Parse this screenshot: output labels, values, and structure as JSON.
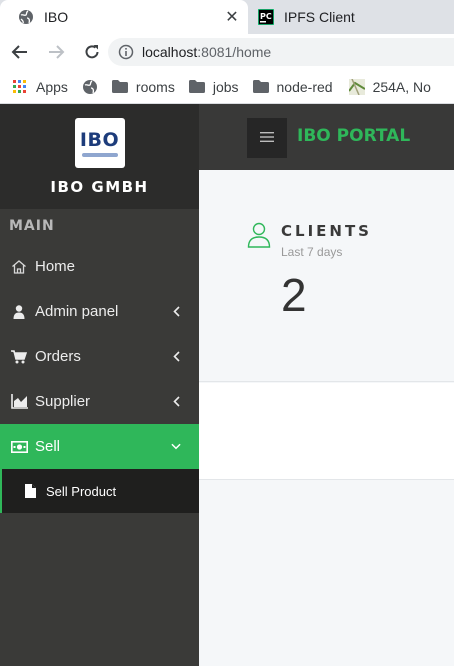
{
  "browser": {
    "tabs": [
      {
        "title": "IBO",
        "favicon": "globe-icon",
        "active": true
      },
      {
        "title": "IPFS Client",
        "favicon": "pycharm-icon",
        "active": false
      }
    ],
    "url": {
      "host": "localhost",
      "rest": ":8081/home"
    },
    "bookmarks": [
      {
        "label": "Apps",
        "icon": "apps-grid-icon"
      },
      {
        "label": "",
        "icon": "globe-icon"
      },
      {
        "label": "rooms",
        "icon": "folder-icon"
      },
      {
        "label": "jobs",
        "icon": "folder-icon"
      },
      {
        "label": "node-red",
        "icon": "folder-icon"
      },
      {
        "label": "254A, No",
        "icon": "map-thumbnail-icon"
      }
    ]
  },
  "sidebar": {
    "logo_text": "IBO",
    "brand_name": "IBO GMBH",
    "section_label": "MAIN",
    "items": [
      {
        "label": "Home",
        "icon": "home-icon",
        "has_chevron": false
      },
      {
        "label": "Admin panel",
        "icon": "user-icon",
        "has_chevron": true
      },
      {
        "label": "Orders",
        "icon": "cart-icon",
        "has_chevron": true
      },
      {
        "label": "Supplier",
        "icon": "chart-icon",
        "has_chevron": true
      },
      {
        "label": "Sell",
        "icon": "money-icon",
        "has_chevron": true,
        "expanded": true
      }
    ],
    "submenu": [
      {
        "label": "Sell Product",
        "icon": "file-icon"
      }
    ]
  },
  "header": {
    "title": "IBO PORTAL"
  },
  "stats": {
    "title": "CLIENTS",
    "subtitle": "Last 7 days",
    "value": "2",
    "icon": "user-outline-icon"
  },
  "colors": {
    "accent": "#2fb75a",
    "sidebar_bg": "#3a3a38",
    "brand_bg": "#2c2c2b",
    "header_bg": "#393938",
    "logo_blue": "#1d3c7b"
  }
}
